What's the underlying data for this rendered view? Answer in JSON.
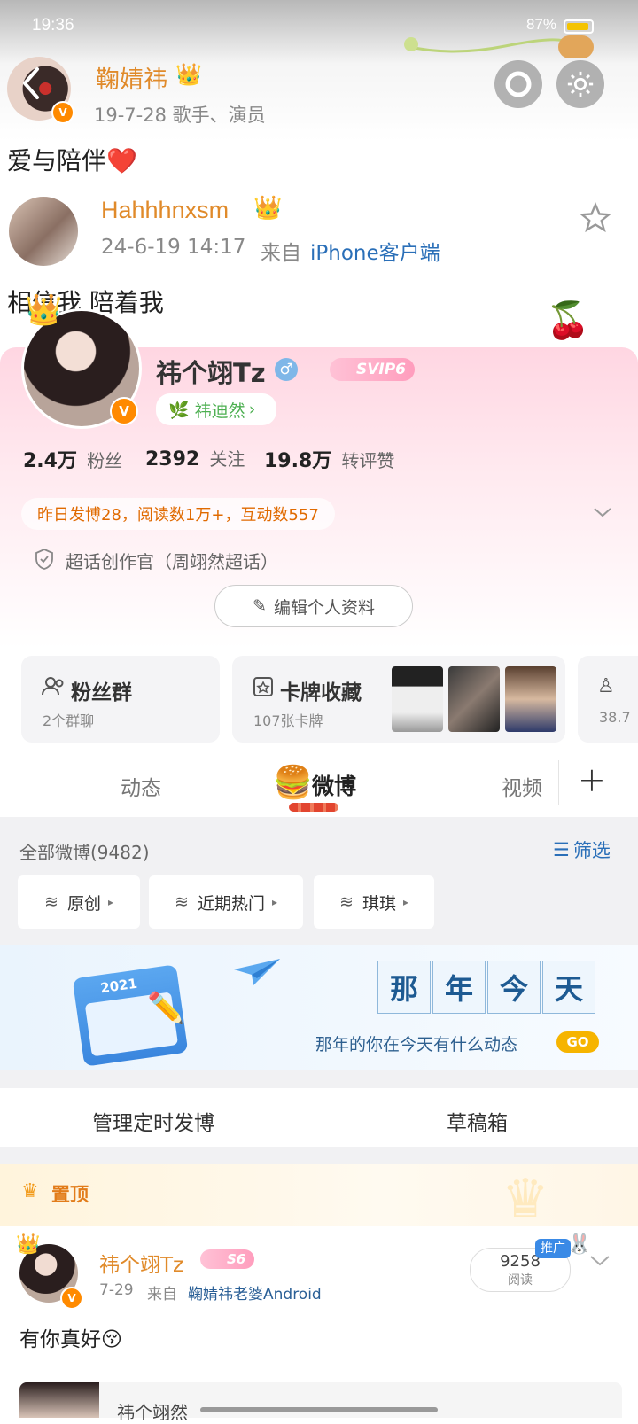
{
  "status_bar": {
    "time": "19:36",
    "battery": "87%"
  },
  "post1": {
    "name": "鞠婧祎",
    "meta": "19-7-28  歌手、演员",
    "text": "爱与陪伴❤️"
  },
  "post2": {
    "name": "Hahhhnxsm",
    "date": "24-6-19 14:17",
    "source_prefix": "来自",
    "source": "iPhone客户端",
    "text": "相信我 陪着我"
  },
  "profile": {
    "name": "祎个翊Tz",
    "svip": "SVIP6",
    "fan_badge": "祎迪然",
    "stats": [
      {
        "num": "2.4万",
        "label": "粉丝"
      },
      {
        "num": "2392",
        "label": "关注"
      },
      {
        "num": "19.8万",
        "label": "转评赞"
      }
    ],
    "activity": "昨日发博28，阅读数1万+，互动数557",
    "title": "超话创作官（周翊然超话）",
    "edit_button": "编辑个人资料"
  },
  "tiles": [
    {
      "title": "粉丝群",
      "sub": "2个群聊"
    },
    {
      "title": "卡牌收藏",
      "sub": "107张卡牌"
    },
    {
      "title": "",
      "sub": "38.7"
    }
  ],
  "tabs": {
    "dynamics": "动态",
    "weibo": "微博",
    "video": "视频",
    "add": "+"
  },
  "feed": {
    "all_count": "全部微博(9482)",
    "filter_label": "筛选",
    "filters": [
      "原创",
      "近期热门",
      "琪琪"
    ]
  },
  "banner": {
    "chars": [
      "那",
      "年",
      "今",
      "天"
    ],
    "year": "2021",
    "subtitle": "那年的你在今天有什么动态",
    "go": "GO"
  },
  "actions": {
    "scheduled": "管理定时发博",
    "drafts": "草稿箱"
  },
  "pinned": {
    "label": "置顶",
    "name": "祎个翊Tz",
    "badge": "S6",
    "date": "7-29",
    "source_prefix": "来自",
    "source": "鞠婧祎老婆Android",
    "promo": "推广",
    "views": "9258",
    "views_label": "阅读",
    "text": "有你真好😚"
  },
  "next_post": {
    "preview": "祎个翊然"
  },
  "colors": {
    "orange": "#e08a2a",
    "blue": "#2a6fb8",
    "pink": "#ffd6e2"
  }
}
